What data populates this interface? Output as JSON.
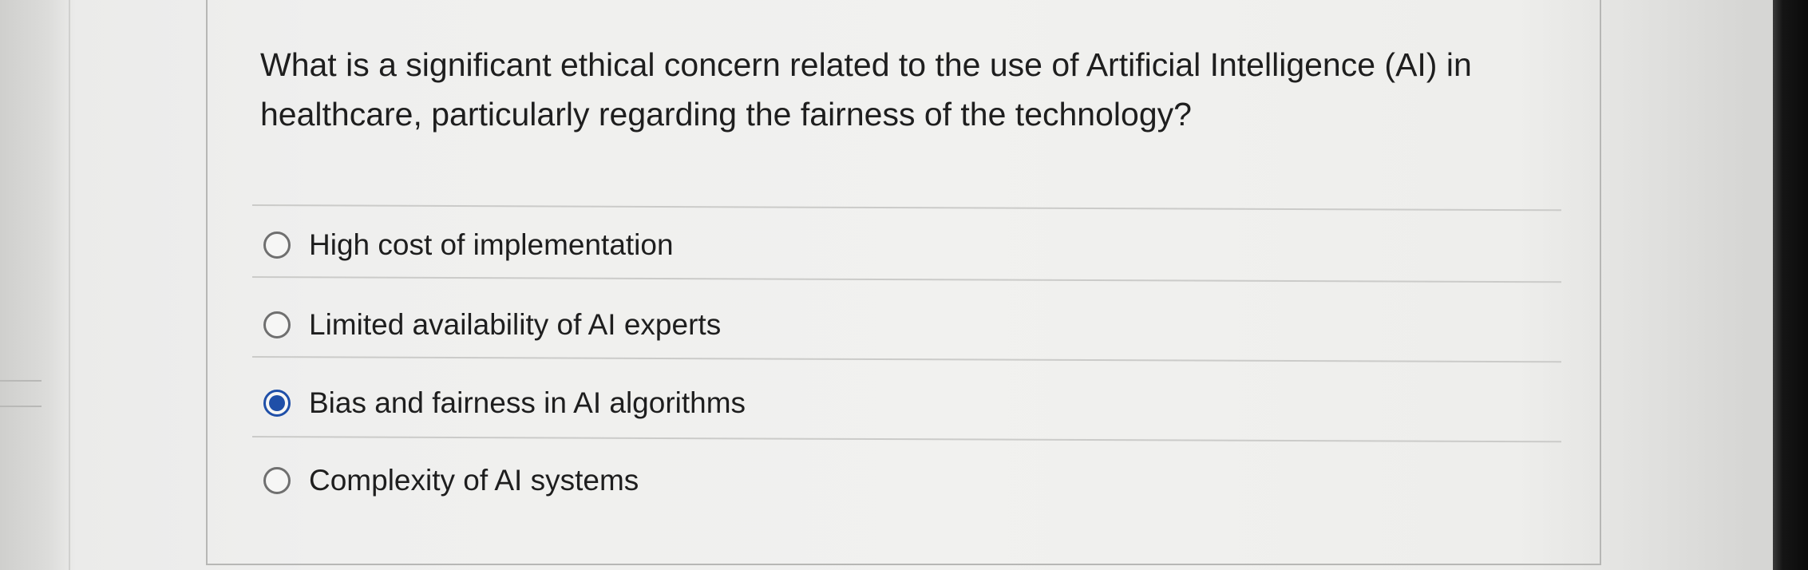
{
  "question": {
    "text": "What is a significant ethical concern related to the use of Artificial Intelligence (AI) in healthcare, particularly regarding the fairness of the technology?"
  },
  "options": [
    {
      "label": "High cost of implementation",
      "selected": false
    },
    {
      "label": "Limited availability of AI experts",
      "selected": false
    },
    {
      "label": "Bias and fairness in AI algorithms",
      "selected": true
    },
    {
      "label": "Complexity of AI systems",
      "selected": false
    }
  ],
  "colors": {
    "accent": "#1f4fa8",
    "text": "#1e1e1e",
    "radio_border": "#6f6f6f"
  }
}
